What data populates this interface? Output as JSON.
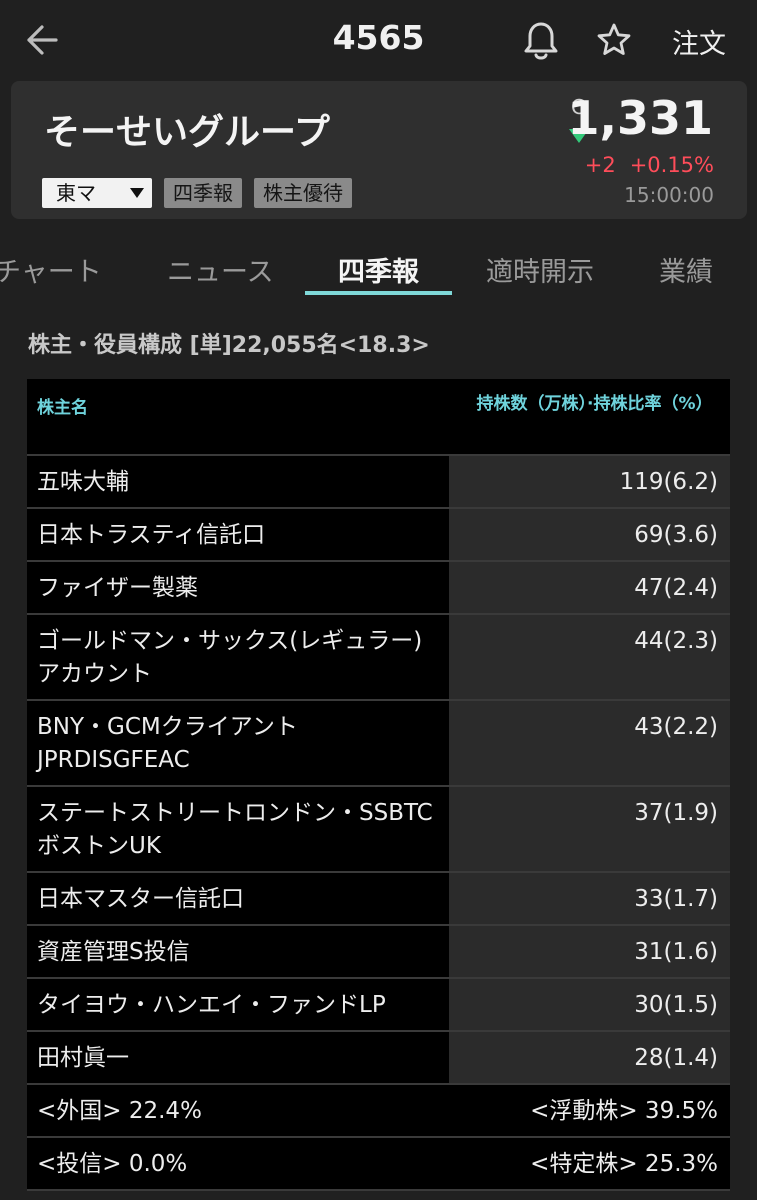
{
  "header": {
    "code": "4565",
    "order_label": "注文"
  },
  "stock": {
    "name": "そーせいグループ",
    "market": "東マ",
    "tags": [
      "四季報",
      "株主優待"
    ],
    "price_flag": "C",
    "price": "1,331",
    "change": "+2",
    "change_pct": "+0.15%",
    "time": "15:00:00",
    "colors": {
      "down_arrow": "#33c97a",
      "change": "#ff4d5a"
    }
  },
  "tabs": [
    "チャート",
    "ニュース",
    "四季報",
    "適時開示",
    "業績"
  ],
  "active_tab": "四季報",
  "section": {
    "title": "株主・役員構成 [単]22,055名<18.3>"
  },
  "table": {
    "headers": {
      "name": "株主名",
      "shares": "持株数（万株）·持株比率（%）"
    },
    "rows": [
      {
        "name": "五味大輔",
        "shares": "119(6.2)"
      },
      {
        "name": "日本トラスティ信託口",
        "shares": "69(3.6)"
      },
      {
        "name": "ファイザー製薬",
        "shares": "47(2.4)"
      },
      {
        "name": "ゴールドマン・サックス(レギュラー)アカウント",
        "shares": "44(2.3)"
      },
      {
        "name": "BNY・GCMクライアントJPRDISGFEAC",
        "shares": "43(2.2)"
      },
      {
        "name": "ステートストリートロンドン・SSBTCボストンUK",
        "shares": "37(1.9)"
      },
      {
        "name": "日本マスター信託口",
        "shares": "33(1.7)"
      },
      {
        "name": "資産管理S投信",
        "shares": "31(1.6)"
      },
      {
        "name": "タイヨウ・ハンエイ・ファンドLP",
        "shares": "30(1.5)"
      },
      {
        "name": "田村眞一",
        "shares": "28(1.4)"
      }
    ],
    "summary": [
      {
        "left": "<外国> 22.4%",
        "right": "<浮動株> 39.5%"
      },
      {
        "left": "<投信> 0.0%",
        "right": "<特定株> 25.3%"
      }
    ]
  }
}
